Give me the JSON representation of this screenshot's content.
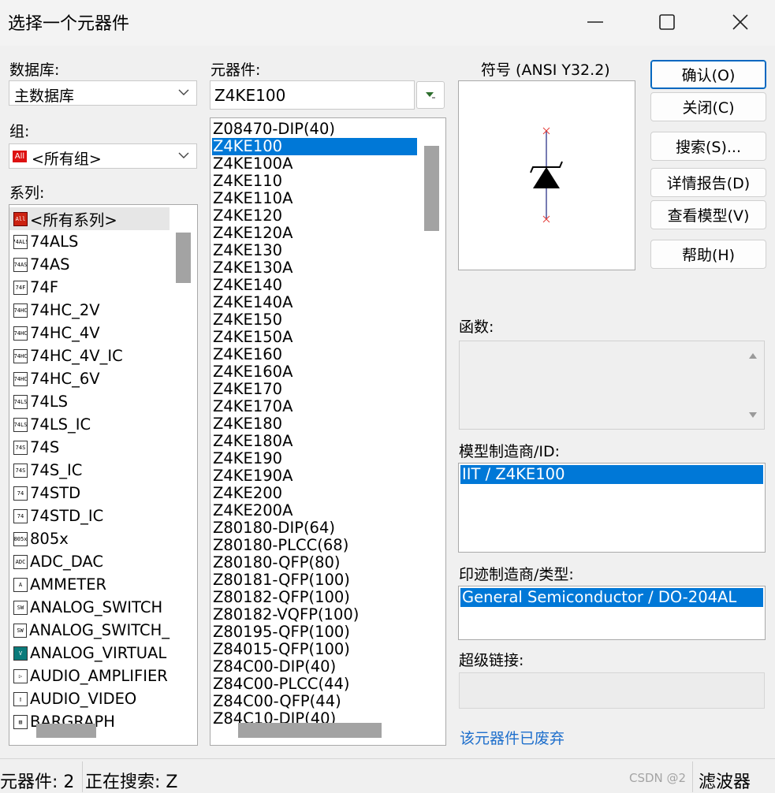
{
  "window": {
    "title": "选择一个元器件"
  },
  "database": {
    "label": "数据库:",
    "selected": "主数据库"
  },
  "group": {
    "label": "组:",
    "selected": "<所有组>",
    "icon_text": "All"
  },
  "family": {
    "label": "系列:",
    "items": [
      {
        "label": "<所有系列>",
        "icon": "All"
      },
      {
        "label": "74ALS",
        "icon": "74ALS"
      },
      {
        "label": "74AS",
        "icon": "74AS"
      },
      {
        "label": "74F",
        "icon": "74F"
      },
      {
        "label": "74HC_2V",
        "icon": "74HC"
      },
      {
        "label": "74HC_4V",
        "icon": "74HC"
      },
      {
        "label": "74HC_4V_IC",
        "icon": "74HC"
      },
      {
        "label": "74HC_6V",
        "icon": "74HC"
      },
      {
        "label": "74LS",
        "icon": "74LS"
      },
      {
        "label": "74LS_IC",
        "icon": "74LS"
      },
      {
        "label": "74S",
        "icon": "74S"
      },
      {
        "label": "74S_IC",
        "icon": "74S"
      },
      {
        "label": "74STD",
        "icon": "74"
      },
      {
        "label": "74STD_IC",
        "icon": "74"
      },
      {
        "label": "805x",
        "icon": "805x"
      },
      {
        "label": "ADC_DAC",
        "icon": "ADC"
      },
      {
        "label": "AMMETER",
        "icon": "A"
      },
      {
        "label": "ANALOG_SWITCH",
        "icon": "SW"
      },
      {
        "label": "ANALOG_SWITCH_",
        "icon": "SW"
      },
      {
        "label": "ANALOG_VIRTUAL",
        "icon": "V"
      },
      {
        "label": "AUDIO_AMPLIFIER",
        "icon": "▷"
      },
      {
        "label": "AUDIO_VIDEO",
        "icon": "▯"
      },
      {
        "label": "BARGRAPH",
        "icon": "▥"
      }
    ]
  },
  "component": {
    "label": "元器件:",
    "search_value": "Z4KE100",
    "filter_icon": "filter-icon",
    "items": [
      "Z08470-DIP(40)",
      "Z4KE100",
      "Z4KE100A",
      "Z4KE110",
      "Z4KE110A",
      "Z4KE120",
      "Z4KE120A",
      "Z4KE130",
      "Z4KE130A",
      "Z4KE140",
      "Z4KE140A",
      "Z4KE150",
      "Z4KE150A",
      "Z4KE160",
      "Z4KE160A",
      "Z4KE170",
      "Z4KE170A",
      "Z4KE180",
      "Z4KE180A",
      "Z4KE190",
      "Z4KE190A",
      "Z4KE200",
      "Z4KE200A",
      "Z80180-DIP(64)",
      "Z80180-PLCC(68)",
      "Z80180-QFP(80)",
      "Z80181-QFP(100)",
      "Z80182-QFP(100)",
      "Z80182-VQFP(100)",
      "Z80195-QFP(100)",
      "Z84015-QFP(100)",
      "Z84C00-DIP(40)",
      "Z84C00-PLCC(44)",
      "Z84C00-QFP(44)",
      "Z84C10-DIP(40)"
    ],
    "selected_index": 1
  },
  "symbol": {
    "label": "符号 (ANSI Y32.2)"
  },
  "buttons": {
    "ok": "确认(O)",
    "close": "关闭(C)",
    "search": "搜索(S)...",
    "report": "详情报告(D)",
    "model": "查看模型(V)",
    "help": "帮助(H)"
  },
  "function": {
    "label": "函数:"
  },
  "model_manufacturer": {
    "label": "模型制造商/ID:",
    "items": [
      "IIT / Z4KE100"
    ]
  },
  "footprint": {
    "label": "印迹制造商/类型:",
    "items": [
      "General Semiconductor / DO-204AL"
    ]
  },
  "hyperlink": {
    "label": "超级链接:",
    "deprecated_link": "该元器件已废弃"
  },
  "status": {
    "component_count": "元器件: 2",
    "searching": "正在搜索: Z",
    "filter": "滤波器",
    "watermark": "CSDN @2"
  },
  "colors": {
    "selection": "#0078d7",
    "link": "#1e6fcc",
    "default_button_border": "#0067c0"
  }
}
